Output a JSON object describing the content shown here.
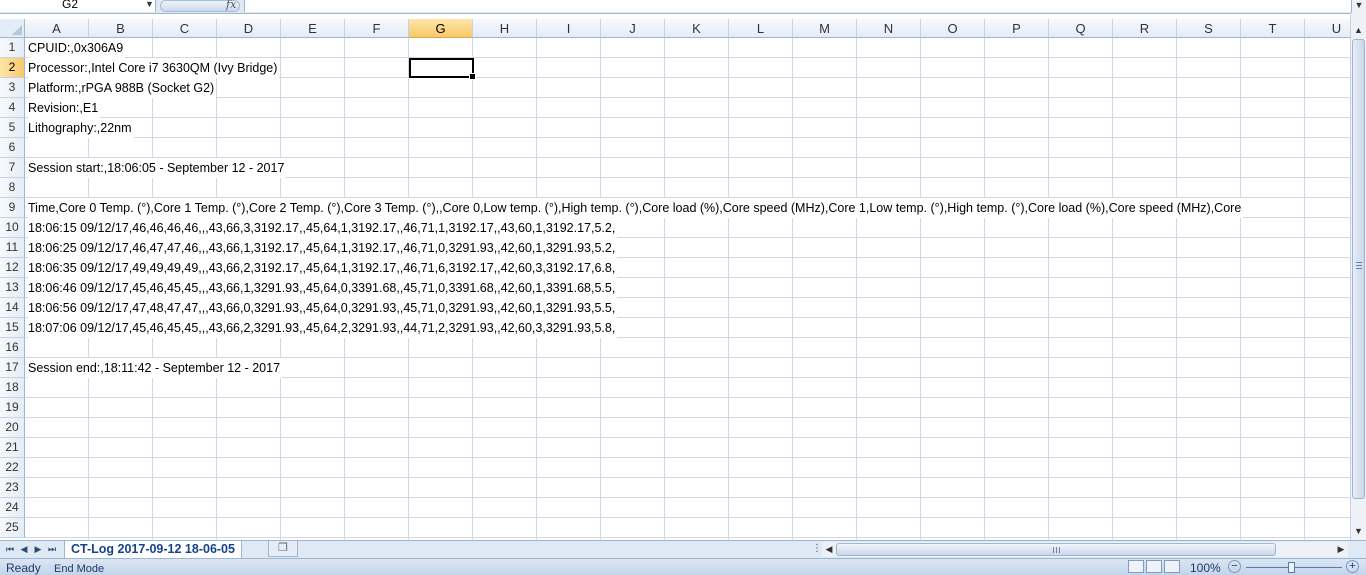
{
  "formula_bar": {
    "name_box": "G2",
    "fx_symbol": "fx",
    "formula": ""
  },
  "columns": [
    "A",
    "B",
    "C",
    "D",
    "E",
    "F",
    "G",
    "H",
    "I",
    "J",
    "K",
    "L",
    "M",
    "N",
    "O",
    "P",
    "Q",
    "R",
    "S",
    "T",
    "U"
  ],
  "selected_column": "G",
  "rows": [
    "1",
    "2",
    "3",
    "4",
    "5",
    "6",
    "7",
    "8",
    "9",
    "10",
    "11",
    "12",
    "13",
    "14",
    "15",
    "16",
    "17",
    "18",
    "19",
    "20",
    "21",
    "22",
    "23",
    "24",
    "25"
  ],
  "selected_row": "2",
  "cells": [
    {
      "row": 1,
      "text": "CPUID:,0x306A9"
    },
    {
      "row": 2,
      "text": "Processor:,Intel Core i7 3630QM (Ivy Bridge)"
    },
    {
      "row": 3,
      "text": "Platform:,rPGA 988B (Socket G2)"
    },
    {
      "row": 4,
      "text": "Revision:,E1"
    },
    {
      "row": 5,
      "text": "Lithography:,22nm"
    },
    {
      "row": 7,
      "text": "Session start:,18:06:05 - September 12 - 2017"
    },
    {
      "row": 9,
      "text": "Time,Core 0 Temp. (°),Core 1 Temp. (°),Core 2 Temp. (°),Core 3 Temp. (°),,Core 0,Low temp. (°),High temp. (°),Core load (%),Core speed (MHz),Core 1,Low temp. (°),High temp. (°),Core load (%),Core speed (MHz),Core"
    },
    {
      "row": 10,
      "text": "18:06:15 09/12/17,46,46,46,46,,,43,66,3,3192.17,,45,64,1,3192.17,,46,71,1,3192.17,,43,60,1,3192.17,5.2,"
    },
    {
      "row": 11,
      "text": "18:06:25 09/12/17,46,47,47,46,,,43,66,1,3192.17,,45,64,1,3192.17,,46,71,0,3291.93,,42,60,1,3291.93,5.2,"
    },
    {
      "row": 12,
      "text": "18:06:35 09/12/17,49,49,49,49,,,43,66,2,3192.17,,45,64,1,3192.17,,46,71,6,3192.17,,42,60,3,3192.17,6.8,"
    },
    {
      "row": 13,
      "text": "18:06:46 09/12/17,45,46,45,45,,,43,66,1,3291.93,,45,64,0,3391.68,,45,71,0,3391.68,,42,60,1,3391.68,5.5,"
    },
    {
      "row": 14,
      "text": "18:06:56 09/12/17,47,48,47,47,,,43,66,0,3291.93,,45,64,0,3291.93,,45,71,0,3291.93,,42,60,1,3291.93,5.5,"
    },
    {
      "row": 15,
      "text": "18:07:06 09/12/17,45,46,45,45,,,43,66,2,3291.93,,45,64,2,3291.93,,44,71,2,3291.93,,42,60,3,3291.93,5.8,"
    },
    {
      "row": 17,
      "text": "Session end:,18:11:42 - September 12 - 2017"
    }
  ],
  "sheet_tab": "CT-Log 2017-09-12 18-06-05",
  "status_bar": {
    "ready": "Ready",
    "mode": "End Mode",
    "zoom": "100%"
  },
  "colors": {
    "selection_header": "#f8c96b",
    "chrome": "#dfe8f5",
    "sheet_tab_text": "#15428b"
  }
}
